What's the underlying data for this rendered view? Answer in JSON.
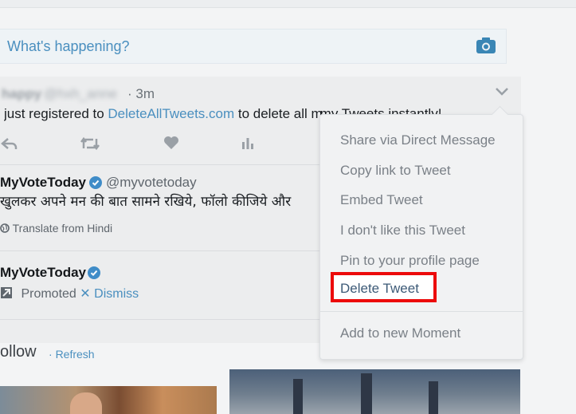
{
  "composer": {
    "placeholder": "What's happening?"
  },
  "tweet1": {
    "time": "· 3m",
    "text_prefix": "just registered to ",
    "link": "DeleteAllTweets.com",
    "text_suffix": " to delete all my Tweets instantly!"
  },
  "tweet2": {
    "name": "MyVoteToday",
    "handle": "@myvotetoday",
    "text": "खुलकर अपने मन की बात सामने रखिये, फॉलो कीजिये और",
    "translate": "Translate from Hindi"
  },
  "tweet3": {
    "name": "MyVoteToday",
    "promoted": "Promoted",
    "dismiss": "Dismiss"
  },
  "follow": {
    "title": "ollow",
    "refresh": "Refresh"
  },
  "menu": {
    "items": [
      "Share via Direct Message",
      "Copy link to Tweet",
      "Embed Tweet",
      "I don't like this Tweet",
      "Pin to your profile page",
      "Delete Tweet",
      "Add to new Moment"
    ]
  },
  "colors": {
    "accent": "#4a8fbf",
    "highlight": "#ec0a0a",
    "verified": "#3f8cc8"
  }
}
